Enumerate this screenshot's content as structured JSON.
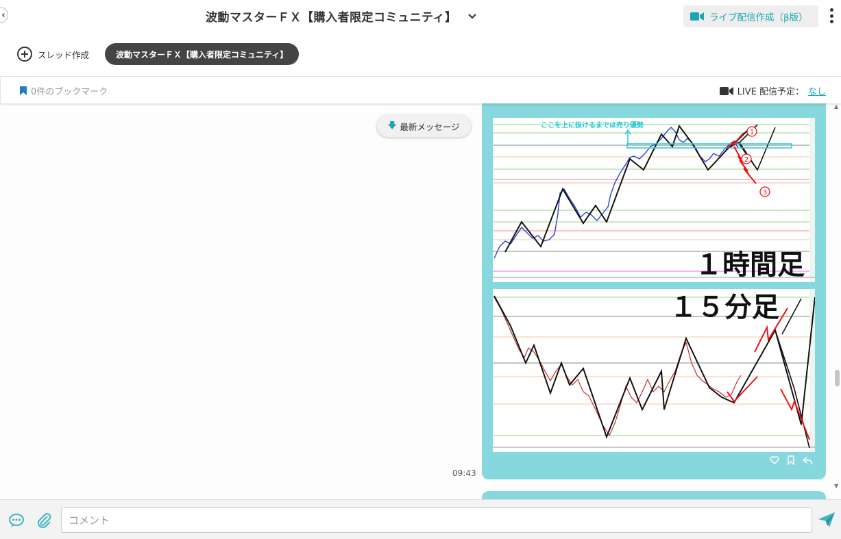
{
  "header": {
    "title": "波動マスターＦＸ【購入者限定コミュニティ】",
    "live_button": "ライブ配信作成（β版）"
  },
  "subbar": {
    "new_thread": "スレッド作成",
    "active_channel": "波動マスターＦＸ【購入者限定コミュニティ】"
  },
  "bookbar": {
    "bookmarks": "0件のブックマーク",
    "live_schedule_label": "LIVE 配信予定：",
    "live_schedule_value": "なし"
  },
  "chat": {
    "latest_button": "最新メッセージ",
    "message": {
      "time": "09:43",
      "chart1": {
        "label": "１時間足",
        "annotation": "ここを上に抜けるまでは売り優勢",
        "marks": [
          "①",
          "②",
          "③"
        ]
      },
      "chart2": {
        "label": "１５分足"
      }
    }
  },
  "composer": {
    "placeholder": "コメント"
  },
  "colors": {
    "accent": "#1ba6b3",
    "bubble": "#86d8de",
    "pill": "#444444"
  }
}
